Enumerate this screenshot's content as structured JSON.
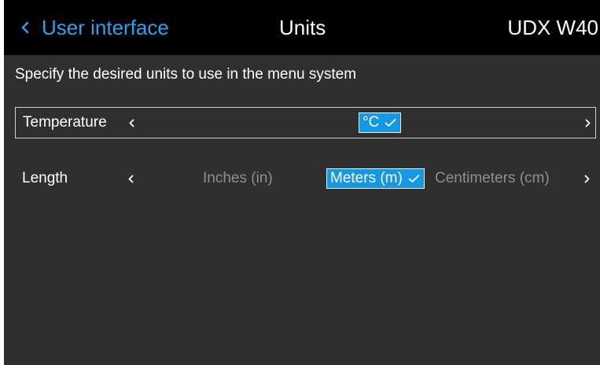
{
  "header": {
    "back_label": "User interface",
    "title": "Units",
    "device": "UDX W40",
    "back_icon": "chevron-left-icon"
  },
  "description": "Specify the desired units to use in the menu system",
  "rows": [
    {
      "label": "Temperature",
      "focused": true,
      "options": [
        {
          "label": "°C",
          "selected": true
        }
      ]
    },
    {
      "label": "Length",
      "focused": false,
      "options": [
        {
          "label": "Inches (in)",
          "selected": false
        },
        {
          "label": "Meters (m)",
          "selected": true
        },
        {
          "label": "Centimeters (cm)",
          "selected": false
        }
      ]
    }
  ],
  "colors": {
    "accent": "#2aa3f2",
    "selected_bg": "#1597e8",
    "background": "#2f2f2f",
    "header_bg": "#000000",
    "dim_text": "#8f8f8f"
  },
  "icons": {
    "prev": "chevron-left-icon",
    "next": "chevron-right-icon",
    "selected_mark": "checkmark-icon"
  }
}
